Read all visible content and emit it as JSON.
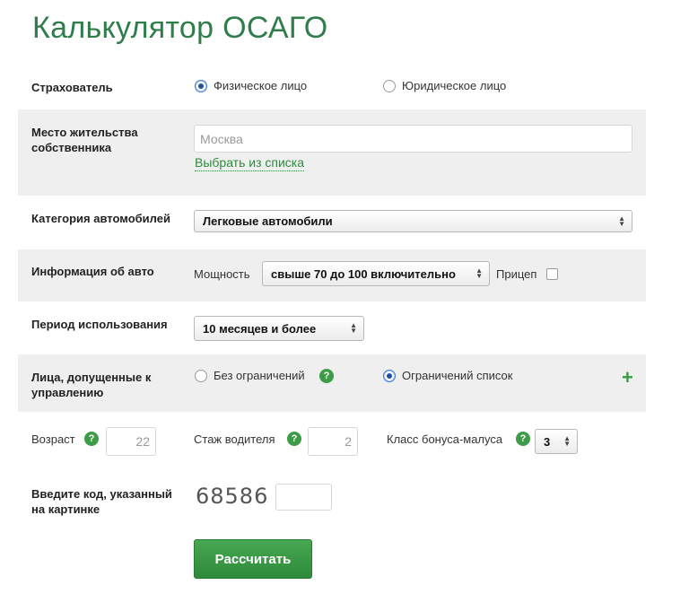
{
  "page": {
    "title": "Калькулятор ОСАГО"
  },
  "insurer": {
    "label": "Страхователь",
    "options": [
      {
        "label": "Физическое лицо",
        "selected": true
      },
      {
        "label": "Юридическое лицо",
        "selected": false
      }
    ]
  },
  "residence": {
    "label": "Место жительства собственника",
    "placeholder": "Москва",
    "value": "",
    "pick_link": "Выбрать из списка"
  },
  "category": {
    "label": "Категория автомобилей",
    "selected": "Легковые автомобили"
  },
  "car_info": {
    "label": "Информация об авто",
    "power_label": "Мощность",
    "power_selected": "свыше 70 до 100 включительно",
    "trailer_label": "Прицеп",
    "trailer_checked": false
  },
  "period": {
    "label": "Период использования",
    "selected": "10 месяцев и более"
  },
  "drivers": {
    "label": "Лица, допущенные к управлению",
    "options": [
      {
        "label": "Без ограничений",
        "selected": false
      },
      {
        "label": "Ограничений список",
        "selected": true
      }
    ]
  },
  "driver_details": {
    "age_label": "Возраст",
    "age_value": "22",
    "experience_label": "Стаж водителя",
    "experience_value": "2",
    "bonus_label": "Класс бонуса-малуса",
    "bonus_selected": "3"
  },
  "captcha": {
    "label": "Введите код, указанный на картинке",
    "code": "68586",
    "value": ""
  },
  "submit": {
    "label": "Рассчитать"
  },
  "colors": {
    "accent": "#2f7d4a",
    "button": "#3e9b48",
    "row_bg": "#efefef"
  },
  "icons": {
    "help": "question-icon",
    "add": "plus-icon"
  }
}
